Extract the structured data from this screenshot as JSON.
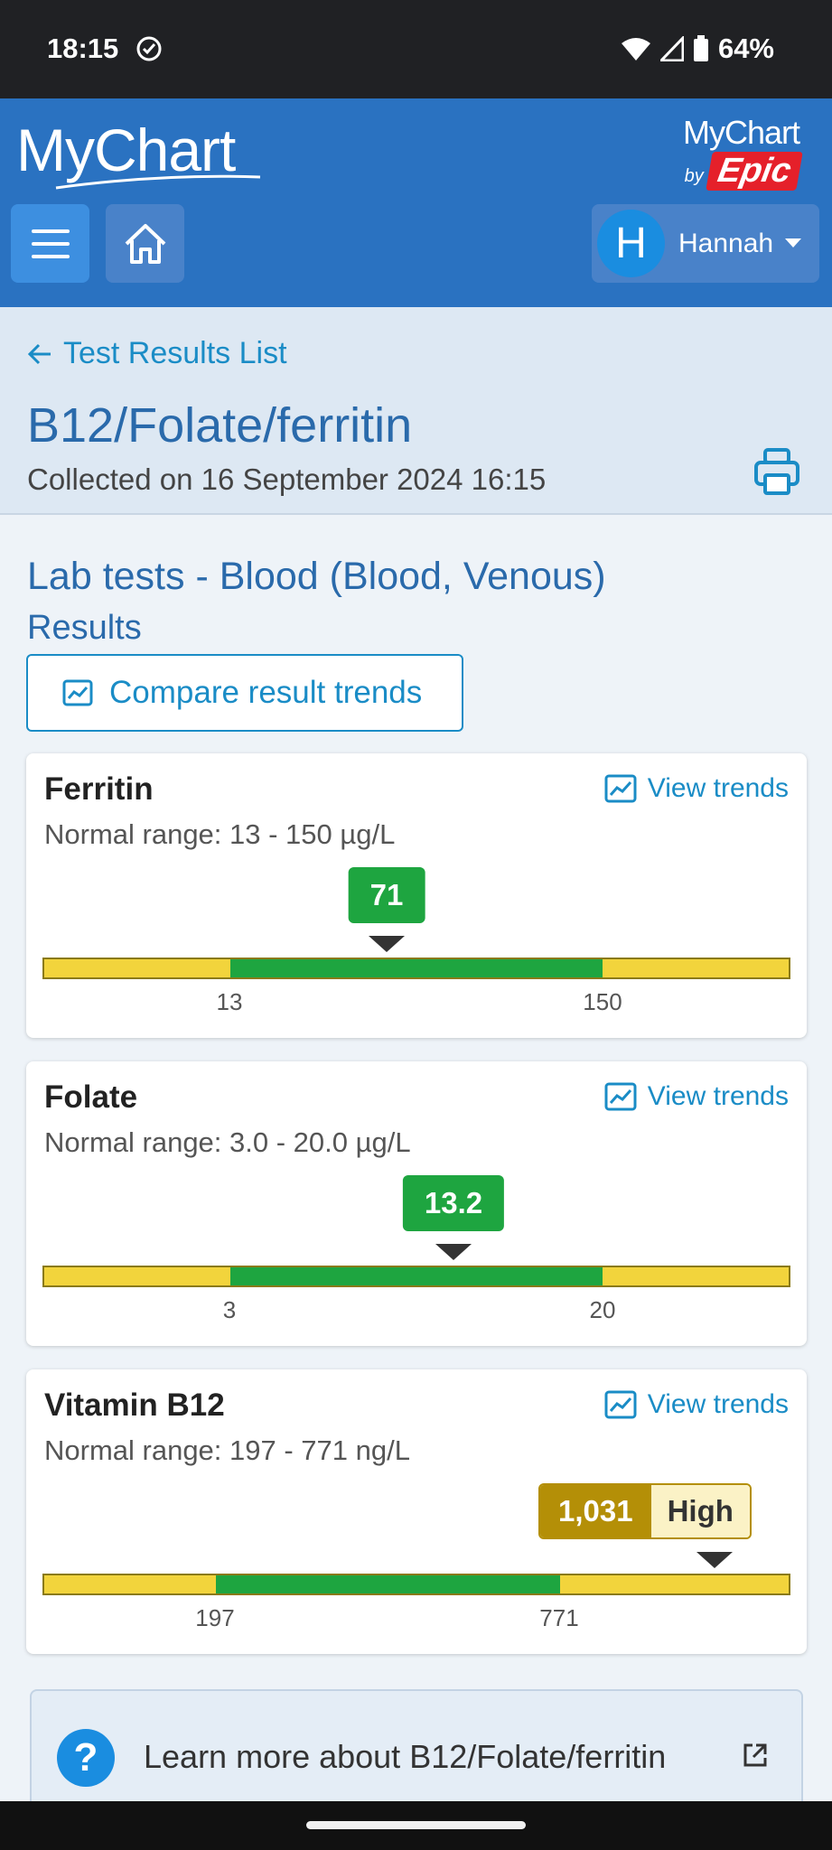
{
  "status_bar": {
    "time": "18:15",
    "battery": "64%"
  },
  "header": {
    "logo_text": "MyChart",
    "logo_epic_top": "MyChart",
    "logo_epic_by": "by",
    "logo_epic_brand": "Epic",
    "user_initial": "H",
    "user_name": "Hannah"
  },
  "title_area": {
    "back_label": "Test Results List",
    "title": "B12/Folate/ferritin",
    "collected": "Collected on 16 September 2024 16:15"
  },
  "content": {
    "section_title": "Lab tests - Blood (Blood, Venous)",
    "results_label": "Results",
    "compare_label": "Compare result trends"
  },
  "results": [
    {
      "name": "Ferritin",
      "view_trends": "View trends",
      "range": "Normal range: 13 - 150 µg/L",
      "value": "71",
      "low_tick": "13",
      "high_tick": "150",
      "value_position": 0.46,
      "normal_start": 0.25,
      "normal_end": 0.75,
      "flag": ""
    },
    {
      "name": "Folate",
      "view_trends": "View trends",
      "range": "Normal range: 3.0 - 20.0 µg/L",
      "value": "13.2",
      "low_tick": "3",
      "high_tick": "20",
      "value_position": 0.55,
      "normal_start": 0.25,
      "normal_end": 0.75,
      "flag": ""
    },
    {
      "name": "Vitamin B12",
      "view_trends": "View trends",
      "range": "Normal range: 197 - 771 ng/L",
      "value": "1,031",
      "low_tick": "197",
      "high_tick": "771",
      "value_position": 0.9,
      "normal_start": 0.23,
      "normal_end": 0.69,
      "flag": "High"
    }
  ],
  "learn_more": {
    "label": "Learn more about B12/Folate/ferritin"
  },
  "colors": {
    "header_blue": "#2a72c1",
    "link_blue": "#1a8cc6",
    "normal_green": "#1ea540",
    "out_of_range_yellow": "#f2d43c",
    "high_badge": "#b48f07"
  }
}
